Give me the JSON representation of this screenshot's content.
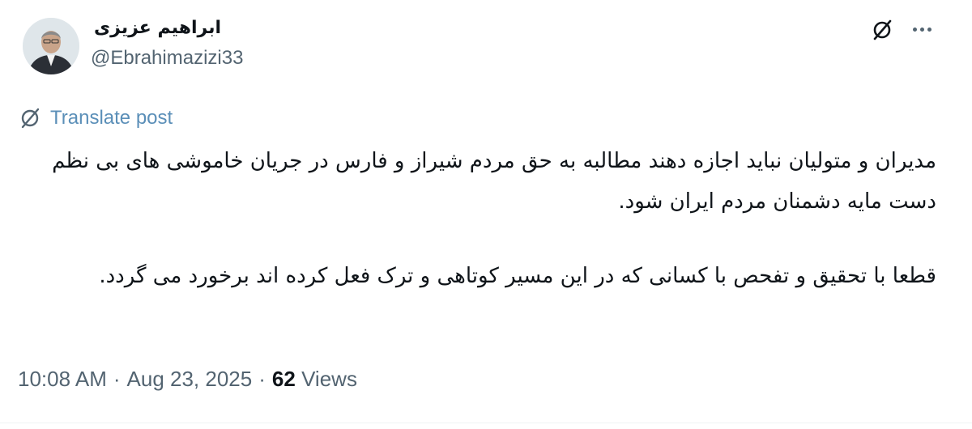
{
  "author": {
    "name": "ابراهیم عزیزی",
    "handle": "@Ebrahimazizi33"
  },
  "translate": {
    "label": "Translate post",
    "icon": "grok-icon"
  },
  "post": {
    "paragraphs": [
      "مدیران و متولیان نباید اجازه دهند مطالبه به حق مردم شیراز و فارس در جریان خاموشی های بی نظم دست مایه دشمنان مردم ایران شود.",
      "قطعا با تحقیق و تفحص با کسانی که در این مسیر کوتاهی و ترک فعل کرده اند برخورد می گردد."
    ]
  },
  "meta": {
    "time": "10:08 AM",
    "date": "Aug 23, 2025",
    "views_count": "62",
    "views_label": "Views"
  },
  "colors": {
    "text": "#0f1419",
    "secondary": "#536471",
    "link": "#5b8fb8"
  }
}
